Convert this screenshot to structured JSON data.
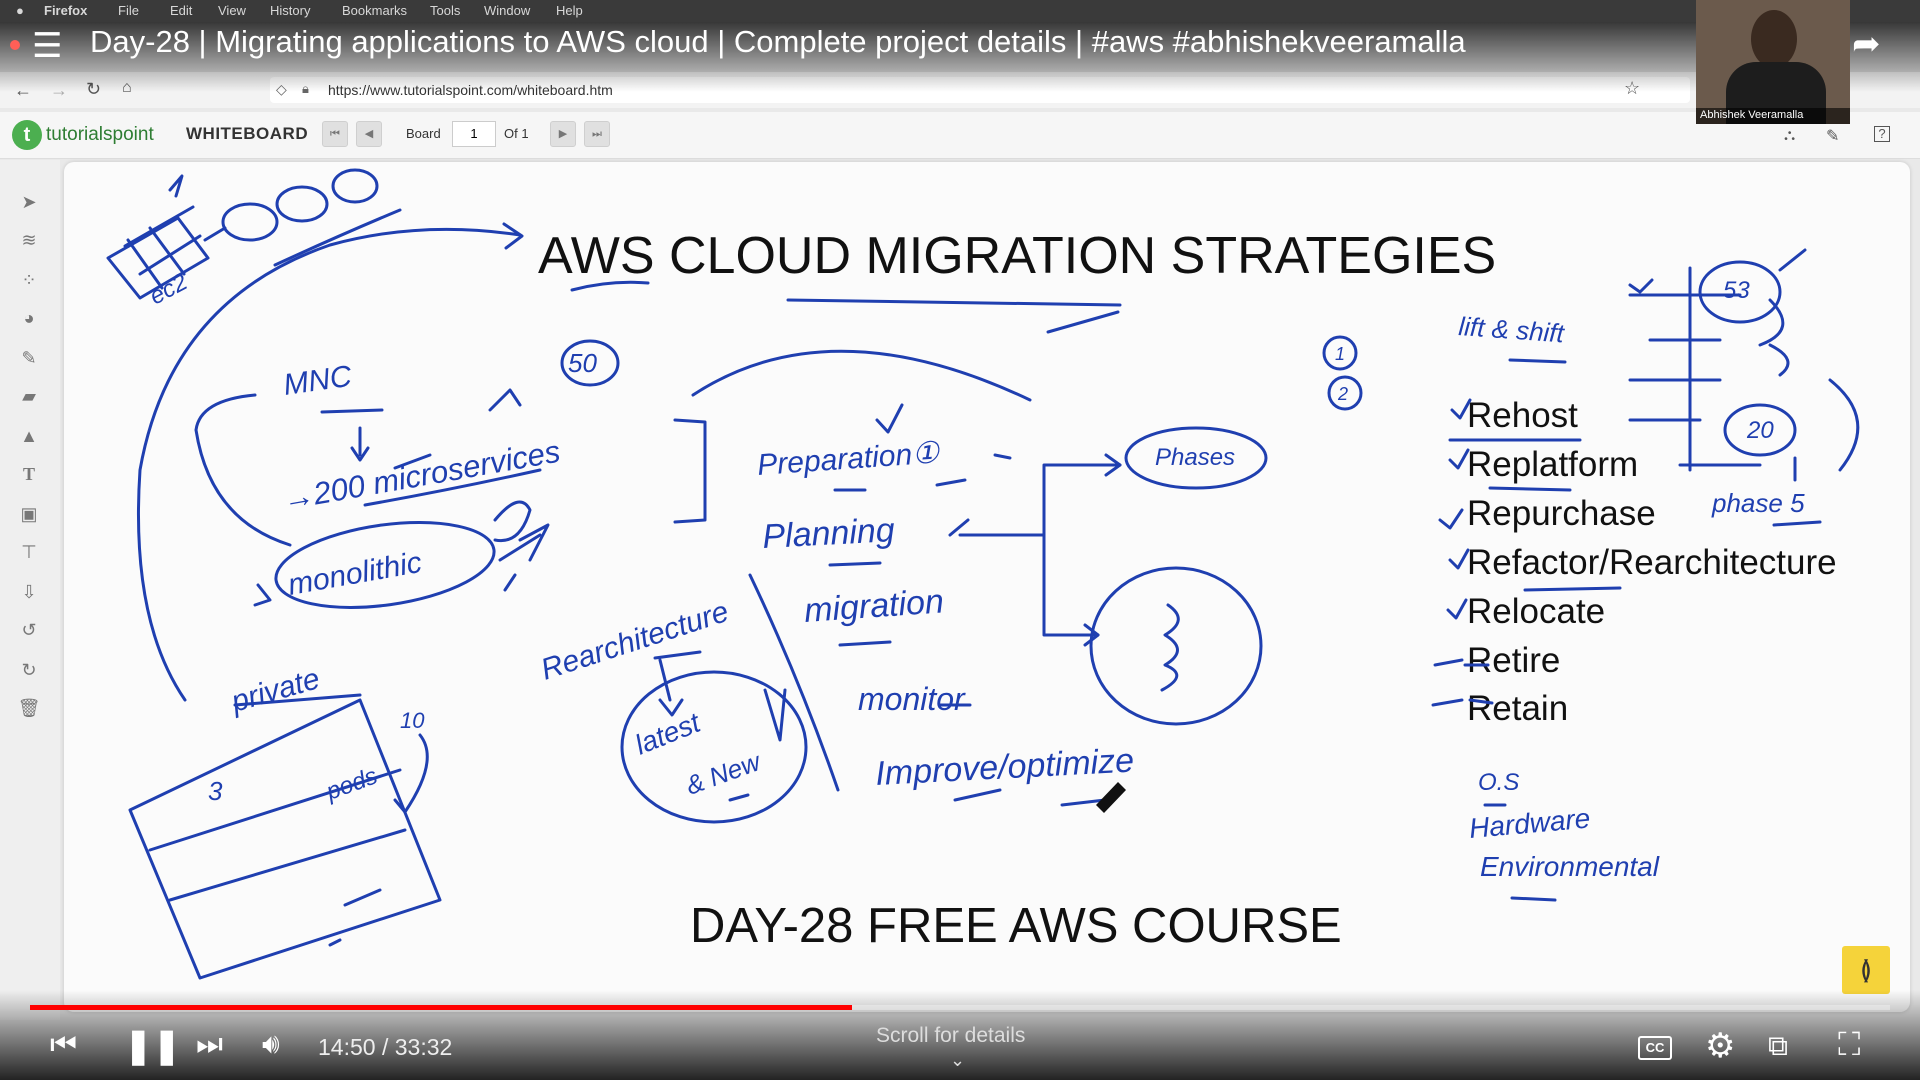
{
  "menubar": {
    "app": "Firefox",
    "items": [
      "File",
      "Edit",
      "View",
      "History",
      "Bookmarks",
      "Tools",
      "Window",
      "Help"
    ]
  },
  "video": {
    "title": "Day-28 | Migrating applications to AWS cloud | Complete project details | #aws #abhishekveeramalla",
    "presenter": "Abhishek Veeramalla",
    "current_time": "14:50",
    "separator": "/",
    "duration": "33:32",
    "progress_fraction": 0.442,
    "scroll_hint": "Scroll for details"
  },
  "browser": {
    "url": "https://www.tutorialspoint.com/whiteboard.htm"
  },
  "whiteboard": {
    "brand": "tutorialspoint",
    "title": "WHITEBOARD",
    "board_label": "Board",
    "board_number": "1",
    "of_label": "Of 1",
    "heading": "AWS CLOUD MIGRATION STRATEGIES",
    "footer": "DAY-28 FREE AWS COURSE",
    "strategies": [
      "Rehost",
      "Replatform",
      "Repurchase",
      "Refactor/Rearchitecture",
      "Relocate",
      "Retire",
      "Retain"
    ]
  },
  "handwriting": {
    "ec2": "ec2",
    "mnc": "MNC",
    "n50": "50",
    "microservices": "→200 microservices",
    "monolithic": "monolithic",
    "private": "private",
    "n3": "3",
    "pods": "pods",
    "n10": "10",
    "preparation": "Preparation①",
    "planning": "Planning",
    "migration": "migration",
    "monitor": "monitor",
    "improve": "Improve/optimize",
    "phases": "Phases",
    "rearchitecture": "Rearchitecture",
    "latest": "latest",
    "new": "& New",
    "lift_shift": "lift & shift",
    "n53": "53",
    "n20": "20",
    "phase5": "phase 5",
    "c1": "1",
    "c2": "2",
    "os": "O.S",
    "hardware": "Hardware",
    "environment": "Environmental"
  },
  "colors": {
    "ink": "#1f3fb0",
    "progress": "#ff0000",
    "canvas": "#fbfbfb"
  },
  "icons": [
    "apple-icon",
    "menu-icon",
    "info-icon",
    "clock-icon",
    "share-icon",
    "back-icon",
    "forward-icon",
    "reload-icon",
    "home-icon",
    "shield-icon",
    "lock-icon",
    "star-icon",
    "select-icon",
    "layers-icon",
    "grid-icon",
    "palette-icon",
    "pencil-icon",
    "eraser-icon",
    "shapes-icon",
    "text-icon",
    "image-icon",
    "present-icon",
    "download-icon",
    "undo-icon",
    "redo-icon",
    "trash-icon",
    "skip-previous-icon",
    "pause-icon",
    "skip-next-icon",
    "volume-icon",
    "cc-icon",
    "settings-icon",
    "cast-icon",
    "exit-fullscreen-icon",
    "expand-chevron-icon"
  ]
}
